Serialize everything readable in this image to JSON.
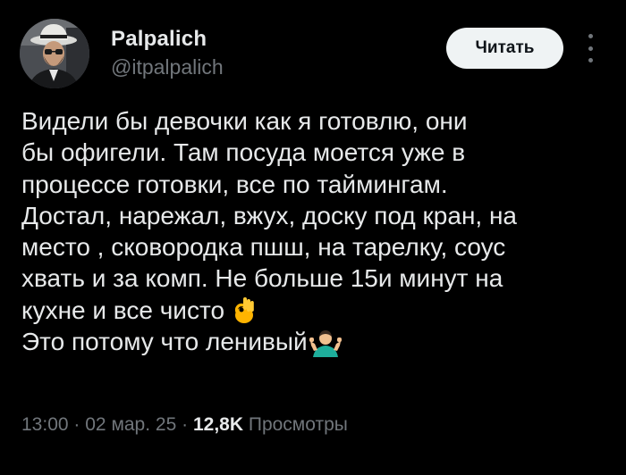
{
  "author": {
    "name": "Palpalich",
    "handle": "@itpalpalich",
    "avatar_icon": "avatar-photo"
  },
  "actions": {
    "follow_label": "Читать",
    "more_icon": "more-vertical-icon"
  },
  "tweet": {
    "lines": [
      "Видели бы девочки как я готовлю, они",
      "бы офигели. Там посуда моется уже в",
      "процессе готовки, все по таймингам.",
      "Достал, нарежал, вжух, доску под кран, на",
      "место , сковородка пшш, на тарелку, соус",
      "хвать и за комп. Не больше 15и минут на",
      "кухне и все чисто",
      "Это потому что ленивый"
    ],
    "emojis": [
      "ok-hand-emoji",
      "person-shrugging-emoji"
    ]
  },
  "meta": {
    "time": "13:00",
    "separator": "·",
    "date": "02 мар. 25",
    "views_count": "12,8K",
    "views_label": "Просмотры"
  },
  "colors": {
    "background": "#000000",
    "text_primary": "#e7e9ea",
    "text_secondary": "#71767b",
    "button_bg": "#eff3f4",
    "button_text": "#0f1419"
  }
}
